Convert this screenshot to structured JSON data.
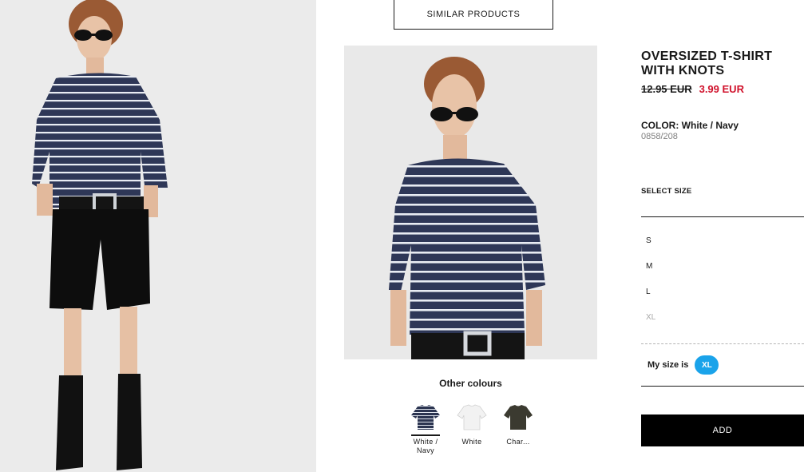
{
  "similar_products": {
    "label": "SIMILAR PRODUCTS"
  },
  "product": {
    "title": "OVERSIZED T-SHIRT WITH KNOTS",
    "price_old": "12.95 EUR",
    "price_new": "3.99 EUR",
    "color_label": "COLOR:",
    "color_value": "White / Navy",
    "reference": "0858/208"
  },
  "size_selector": {
    "heading": "SELECT SIZE",
    "sizes": [
      {
        "label": "S",
        "available": true
      },
      {
        "label": "M",
        "available": true
      },
      {
        "label": "L",
        "available": true
      },
      {
        "label": "XL",
        "available": false
      }
    ],
    "my_size_label": "My size is",
    "my_size_value": "XL"
  },
  "add_button": {
    "label": "ADD"
  },
  "other_colours": {
    "title": "Other colours",
    "swatches": [
      {
        "label": "White /\nNavy",
        "color": "#2b3450",
        "selected": true,
        "icon": "striped-tshirt-icon"
      },
      {
        "label": "White",
        "color": "#f2f2f2",
        "selected": false,
        "icon": "white-tshirt-icon"
      },
      {
        "label": "Char...",
        "color": "#3b3a30",
        "selected": false,
        "icon": "charcoal-tshirt-icon"
      }
    ]
  },
  "colors": {
    "accent_sale": "#d0112b",
    "size_badge": "#1aa3ea",
    "navy_stripe": "#2b3450"
  }
}
